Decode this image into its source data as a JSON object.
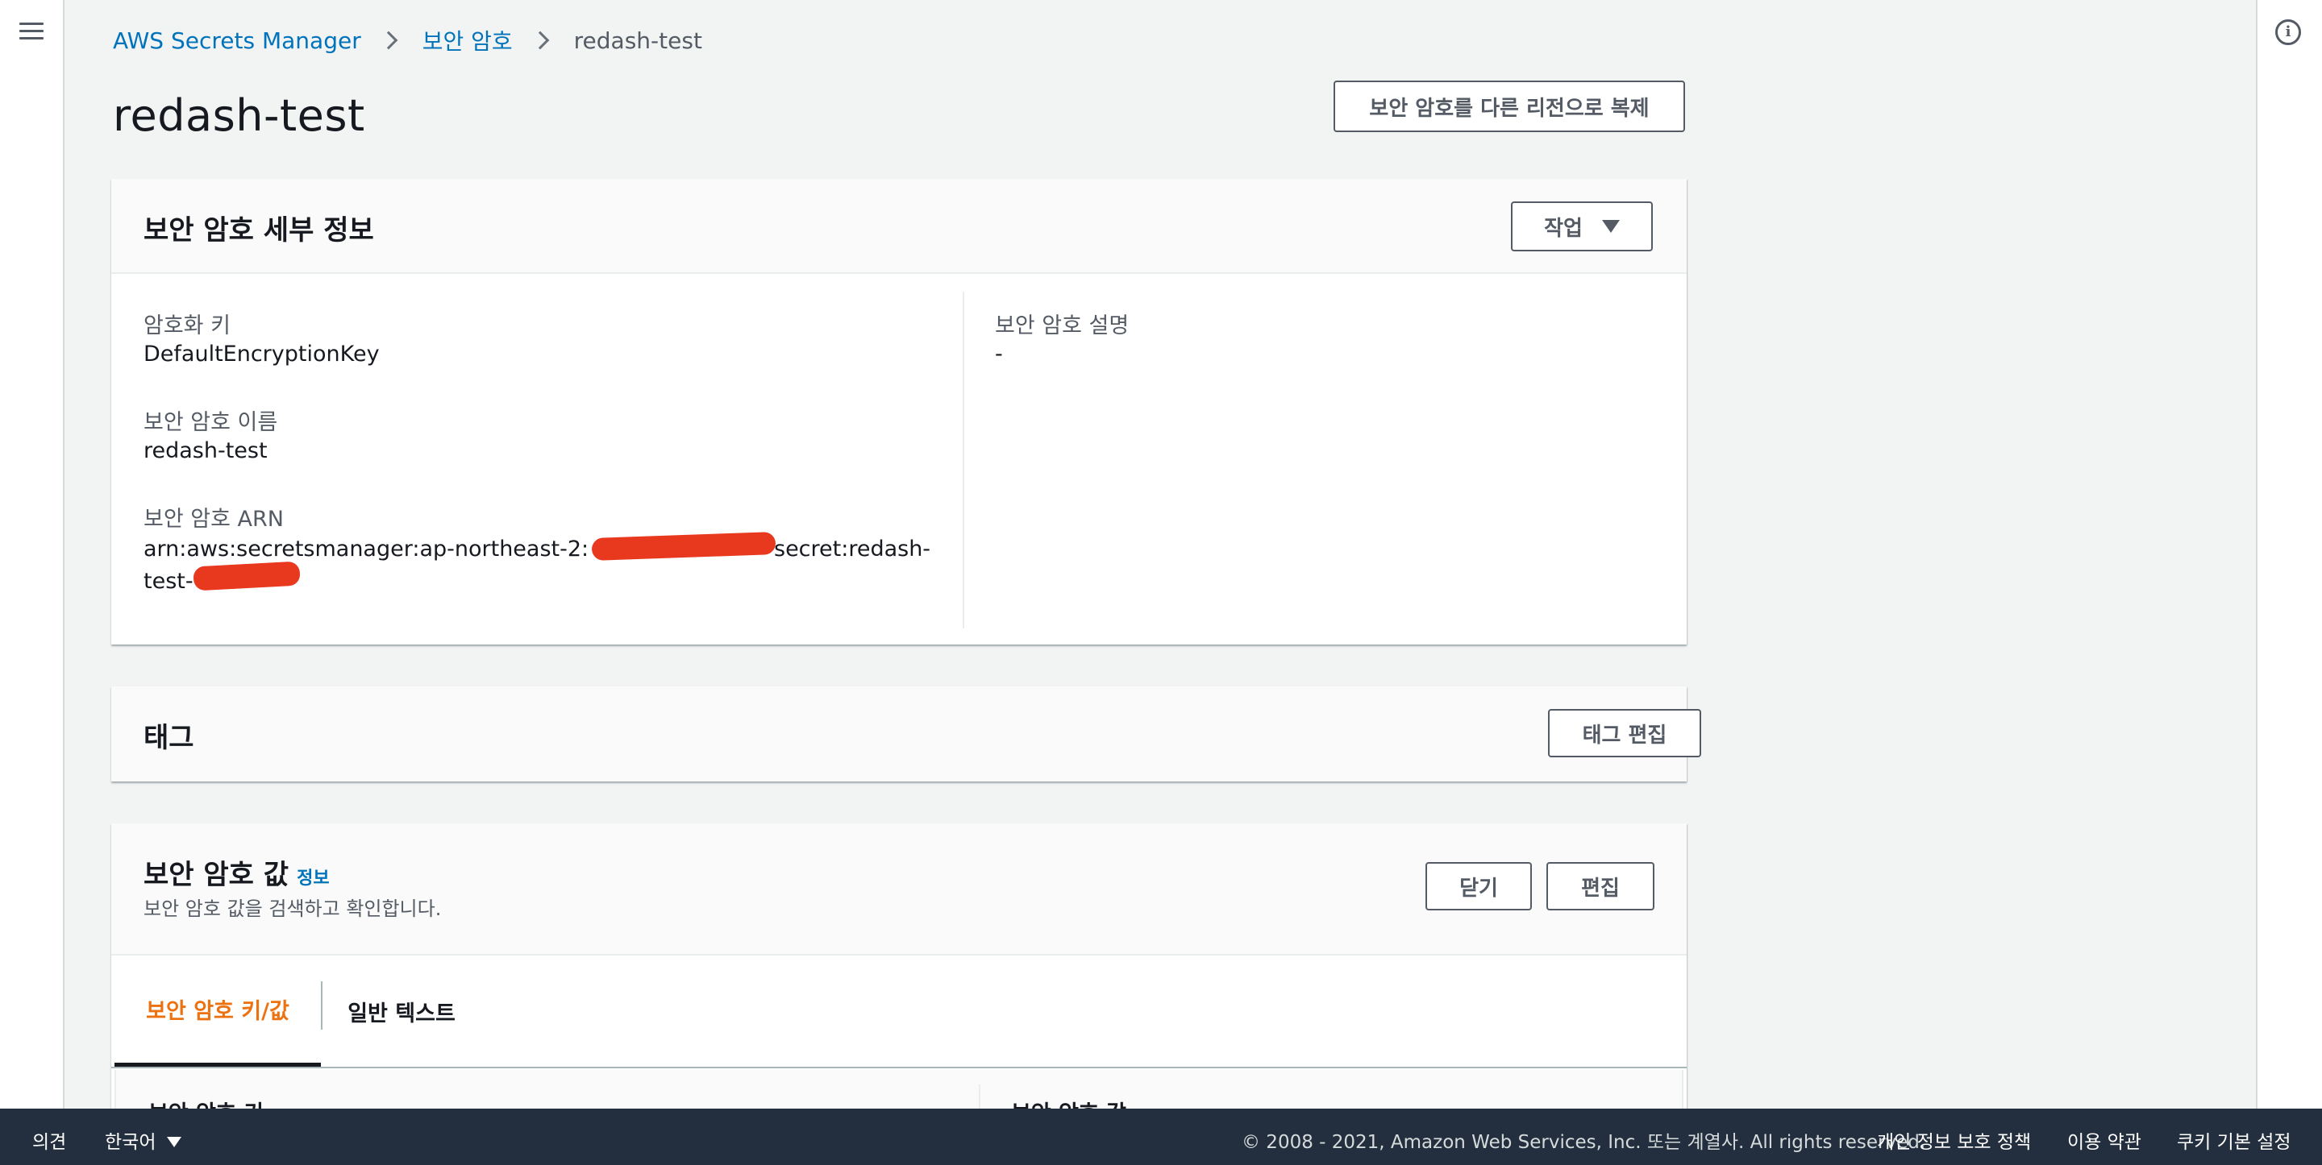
{
  "nav": {
    "menu_icon": "hamburger-menu-icon"
  },
  "help": {
    "info_icon_glyph": "i"
  },
  "breadcrumb": {
    "items": [
      "AWS Secrets Manager",
      "보안 암호"
    ],
    "current": "redash-test"
  },
  "page": {
    "title": "redash-test",
    "replicate_button": "보안 암호를 다른 리전으로 복제"
  },
  "details": {
    "title": "보안 암호 세부 정보",
    "actions_button": "작업",
    "encryption_key_label": "암호화 키",
    "encryption_key_value": "DefaultEncryptionKey",
    "name_label": "보안 암호 이름",
    "name_value": "redash-test",
    "arn_label": "보안 암호 ARN",
    "arn_line1": "arn:aws:secretsmanager:ap-northeast-2:",
    "arn_line1_suffix": "secret:redash-",
    "arn_line2": "test-",
    "description_label": "보안 암호 설명",
    "description_value": "-"
  },
  "tags": {
    "title": "태그",
    "edit_button": "태그 편집"
  },
  "secret_value": {
    "title": "보안 암호 값",
    "info_link": "정보",
    "description": "보안 암호 값을 검색하고 확인합니다.",
    "close_button": "닫기",
    "edit_button": "편집",
    "tabs": [
      {
        "label": "보안 암호 키/값",
        "active": true
      },
      {
        "label": "일반 텍스트",
        "active": false
      }
    ],
    "columns": [
      "보안 암호 키",
      "보안 암호 값"
    ]
  },
  "footer": {
    "feedback": "의견",
    "language": "한국어",
    "copyright": "© 2008 - 2021, Amazon Web Services, Inc. 또는 계열사. All rights reserved.",
    "privacy": "개인 정보 보호 정책",
    "terms": "이용 약관",
    "cookies": "쿠키 기본 설정"
  },
  "colors": {
    "link": "#0073bb",
    "active_tab": "#ec7211",
    "footer_bg": "#232f3e",
    "redaction": "#e8381e"
  }
}
